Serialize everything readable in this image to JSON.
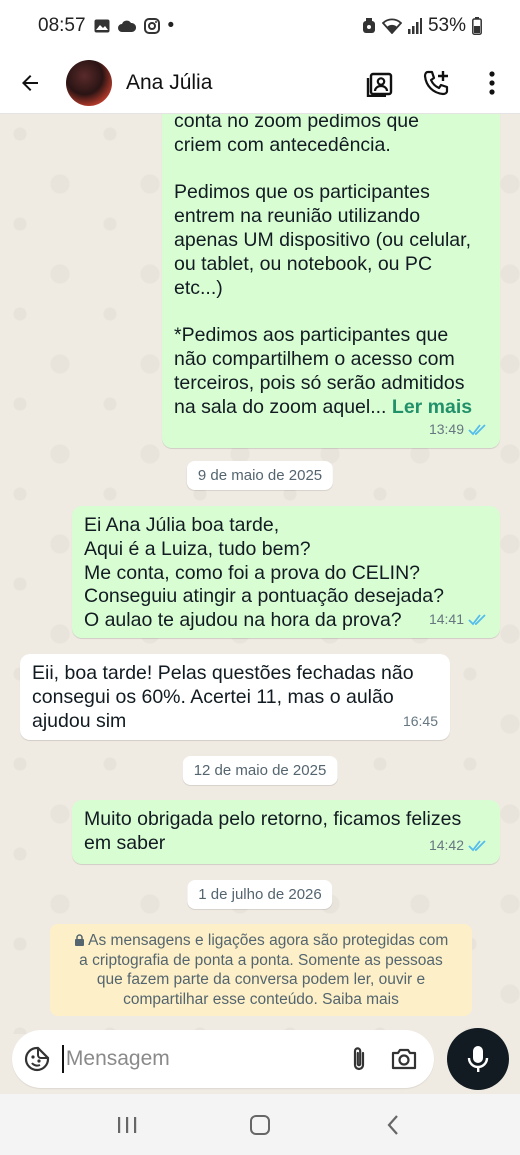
{
  "status": {
    "time": "08:57",
    "dot": "•",
    "battery": "53%"
  },
  "header": {
    "contact_name": "Ana Júlia"
  },
  "messages": [
    {
      "lines": [
        "conta no zoom pedimos que",
        "criem com antecedência.",
        "",
        "Pedimos que os participantes",
        "entrem na reunião utilizando",
        "apenas UM dispositivo (ou celular,",
        "ou tablet, ou notebook, ou PC",
        "etc...)",
        "",
        "*Pedimos aos participantes que",
        "não compartilhem o acesso com",
        "terceiros, pois só serão admitidos",
        "na sala do zoom aquel..."
      ],
      "read_more": "Ler mais",
      "time": "13:49"
    },
    {
      "lines": [
        "Ei Ana Júlia boa tarde,",
        "Aqui é a Luiza, tudo bem?",
        "Me conta, como foi a prova do CELIN?",
        "Conseguiu atingir a pontuação desejada?",
        "O aulao te ajudou na hora da prova?"
      ],
      "time": "14:41"
    },
    {
      "lines": [
        "Eii, boa tarde! Pelas questões fechadas não",
        "consegui os 60%. Acertei 11, mas o aulão",
        "ajudou sim"
      ],
      "time": "16:45"
    },
    {
      "lines": [
        "Muito obrigada pelo retorno, ficamos felizes",
        "em saber"
      ],
      "time": "14:42"
    }
  ],
  "dates": [
    "9 de maio de 2025",
    "12 de maio de 2025",
    "1 de julho de 2026"
  ],
  "system_note": {
    "lines": [
      "As mensagens e ligações agora são protegidas com",
      "a criptografia de ponta a ponta. Somente as pessoas",
      "que fazem parte da conversa podem ler, ouvir e",
      "compartilhar esse conteúdo. Saiba mais"
    ]
  },
  "composer": {
    "placeholder": "Mensagem"
  },
  "colors": {
    "outgoing_bubble": "#d9fdd3",
    "incoming_bubble": "#ffffff",
    "read_ticks": "#53bdeb",
    "link": "#21916a",
    "system_note_bg": "#fdf0c8"
  },
  "icons": {
    "back": "arrow-left-icon",
    "video": "video-call-icon",
    "call": "add-call-icon",
    "menu": "more-vert-icon",
    "emoji": "sticker-icon",
    "attach": "paperclip-icon",
    "camera": "camera-icon",
    "mic": "mic-icon"
  }
}
